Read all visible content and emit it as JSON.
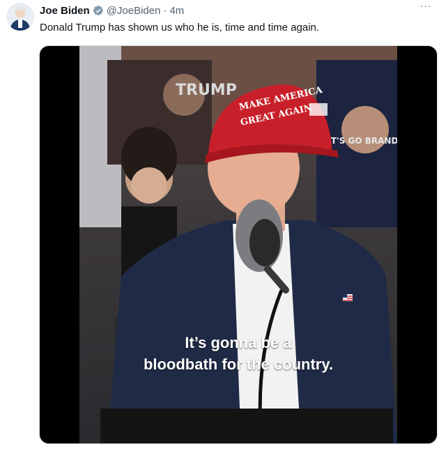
{
  "author": {
    "name": "Joe Biden",
    "handle": "@JoeBiden",
    "separator": "·",
    "time": "4m"
  },
  "menu_label": "···",
  "tweet": {
    "text": "Donald Trump has shown us who he is, time and time again."
  },
  "video": {
    "caption_line1": "It’s gonna be a",
    "caption_line2": "bloodbath for the country.",
    "hat_text_line1": "MAKE AMERICA",
    "hat_text_line2": "GREAT AGAIN",
    "shirt_text_left": "TRUMP",
    "shirt_text_right": "LET'S GO BRANDON"
  },
  "colors": {
    "verified_badge": "#829aab",
    "hat_red": "#c8202a",
    "suit_navy": "#1f2b46"
  },
  "icons": {
    "verified": "verified-badge-icon",
    "more": "more-horizontal-icon"
  }
}
